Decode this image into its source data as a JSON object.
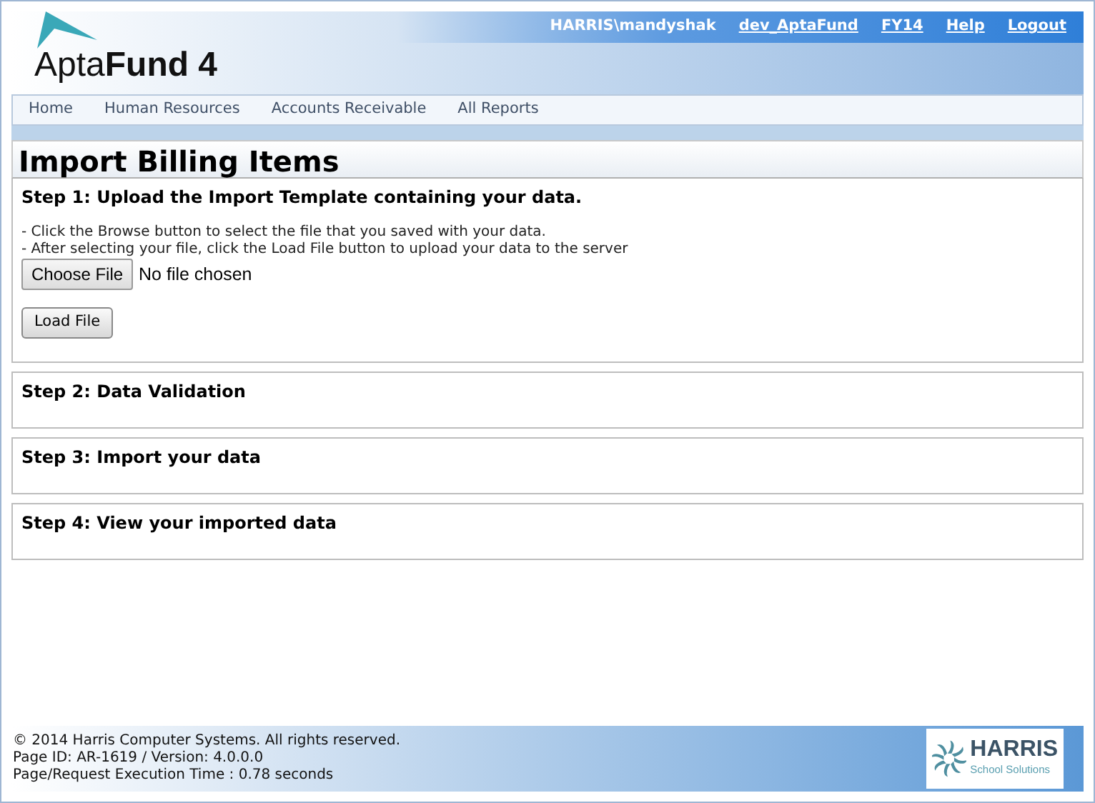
{
  "header": {
    "logo": "Apta**Fund 4**",
    "user": "HARRIS\\mandyshak",
    "links": [
      "dev_AptaFund",
      "FY14",
      "Help",
      "Logout"
    ]
  },
  "nav": {
    "items": [
      "Home",
      "Human Resources",
      "Accounts Receivable",
      "All Reports"
    ]
  },
  "page_title": "Import Billing Items",
  "steps": [
    {
      "title": "Step 1: Upload the Import Template containing your data.",
      "expanded": true,
      "instructions": [
        "- Click the Browse button to select the file that you saved with your data.",
        "- After selecting your file, click the Load File button to upload your data to the server"
      ],
      "file_button": "Choose File",
      "file_status": "No file chosen",
      "load_button": "Load File"
    },
    {
      "title": "Step 2: Data Validation",
      "expanded": false
    },
    {
      "title": "Step 3: Import your data",
      "expanded": false
    },
    {
      "title": "Step 4: View your imported data",
      "expanded": false
    }
  ],
  "footer": {
    "lines": [
      "© 2014 Harris Computer Systems. All rights reserved.",
      "Page ID: AR-1619 / Version: 4.0.0.0",
      "Page/Request Execution Time : 0.78 seconds"
    ],
    "logo_name": "HARRIS",
    "logo_tagline": "School Solutions"
  }
}
